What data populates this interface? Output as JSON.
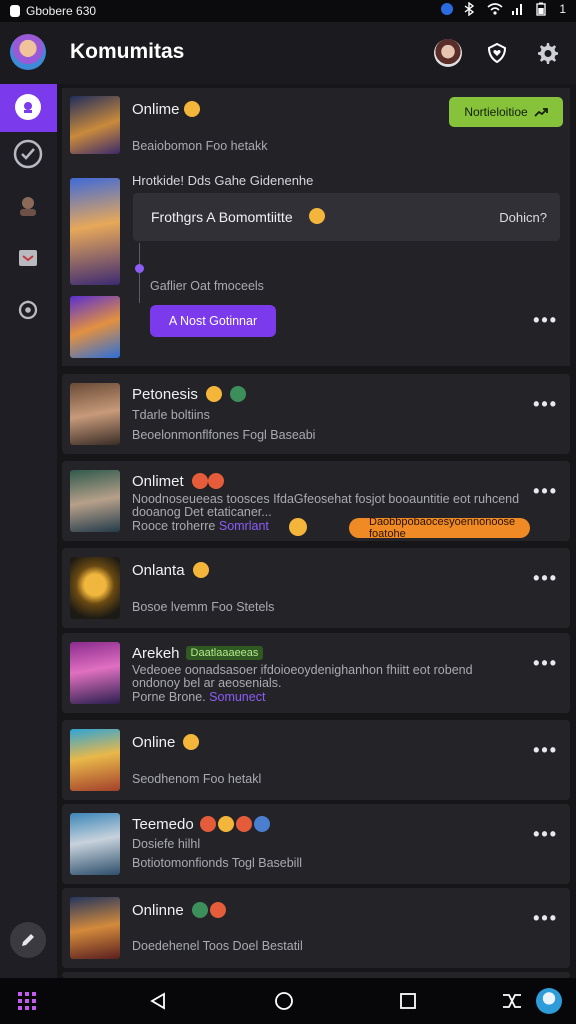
{
  "status_bar": {
    "left_text": "Gbobere 630",
    "right_text": "1"
  },
  "header": {
    "title": "Komumitas"
  },
  "feed": {
    "main_card": {
      "name": "Onlime",
      "notify_button": "Nortieloitioe",
      "sub_line": "Beaiobomon Foo hetakk",
      "event_label": "Hrotkide! Dds Gahe Gidenenhe",
      "event_title": "Frothgrs A Bomomtiitte",
      "event_action": "Dohicn?",
      "timeline_note": "Gaflier Oat fmoceels",
      "join_button": "A Nost Gotinnar"
    },
    "cards": [
      {
        "name": "Petonesis",
        "line1": "Tdarle boltiins",
        "line2": "Beoelonmonflfones Fogl Baseabi"
      },
      {
        "name": "Onlimet",
        "line1": "Noodnoseueeas toosces IfdaGfeosehat fosjot booauntitie eot ruhcend",
        "line2": "dooanog Det etaticaner...",
        "line3_prefix": "Rooce troherre",
        "line3_link": "Somrlant",
        "pill": "Daobbpobaocesyoennonoose foatohe"
      },
      {
        "name": "Onlanta",
        "line1": "Bosoe lvemm Foo Stetels"
      },
      {
        "name": "Arekeh",
        "badge": "Daatlaaaeeas",
        "line1": "Vedeoee oonadsasoer ifdoioeoydenighanhon fhiitt eot robend",
        "line2": "ondonoy bel ar aeosenials.",
        "line3_prefix": "Porne Brone.",
        "line3_link": "Somunect"
      },
      {
        "name": "Online",
        "line1": "Seodhenom Foo hetakl"
      },
      {
        "name": "Teemedo",
        "line1": "Dosiefe hilhl",
        "line2": "Botiotomonfionds Togl Basebill"
      },
      {
        "name": "Onlinne",
        "line1": "Doedehenel Toos Doel Bestatil"
      }
    ],
    "more_label": "•••"
  },
  "colors": {
    "accent": "#7c3aed",
    "notify_green": "#86c33b",
    "pill_orange": "#f08a24"
  }
}
